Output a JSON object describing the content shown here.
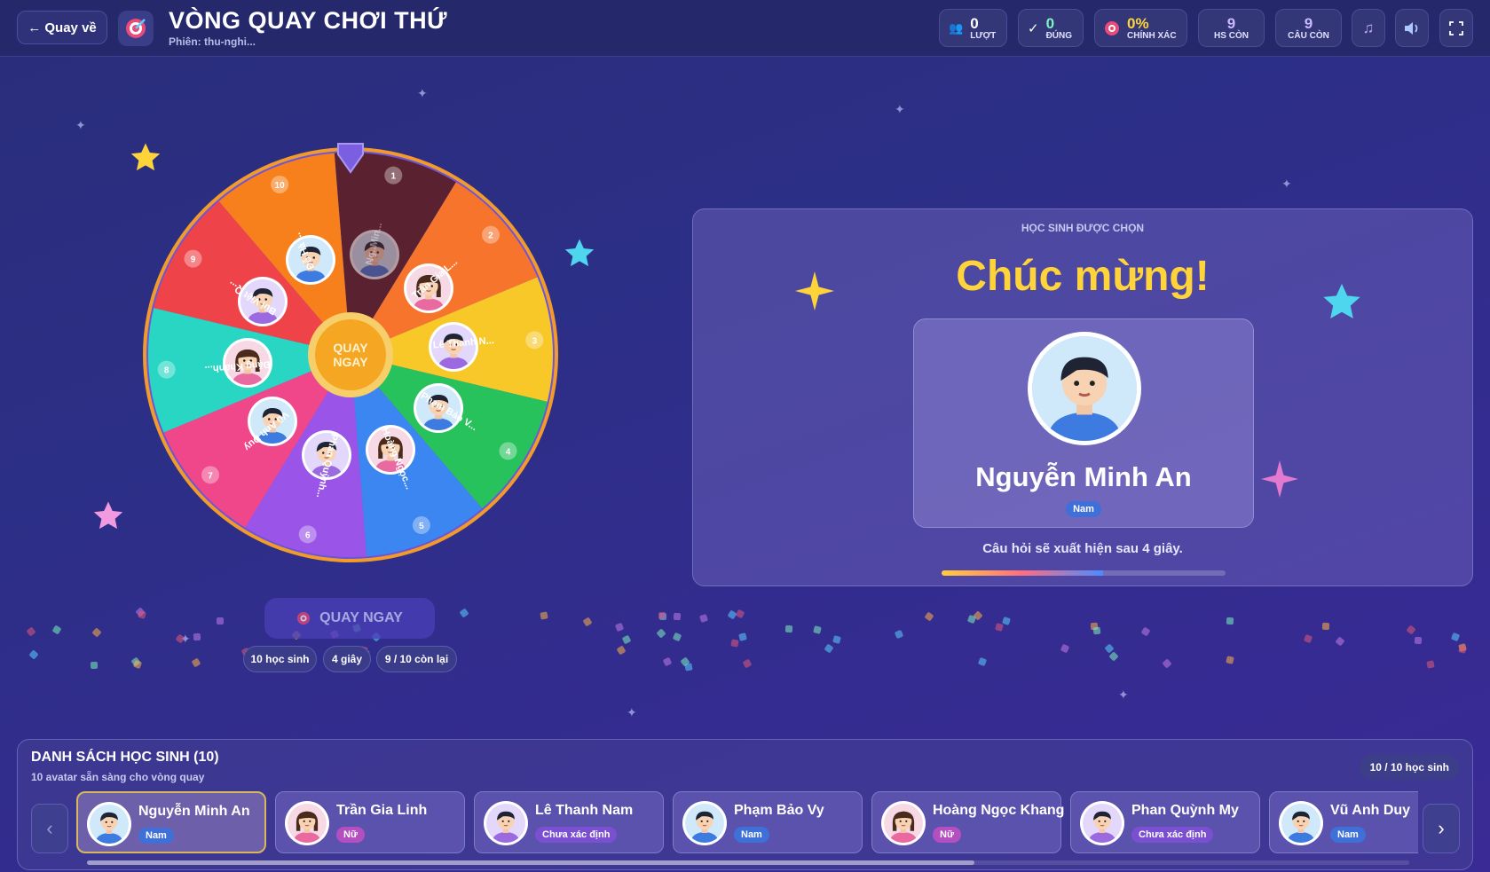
{
  "header": {
    "back_label": "← Quay về",
    "title": "VÒNG QUAY CHƠI THỨ",
    "session": "Phiên: thu-nghi...",
    "stats": [
      {
        "value": "0",
        "label": "LƯỢT",
        "icon": "users-icon",
        "color": "#ffffff"
      },
      {
        "value": "0",
        "label": "ĐÚNG",
        "icon": "check-icon",
        "color": "#7bf2c0"
      },
      {
        "value": "0%",
        "label": "CHÍNH XÁC",
        "icon": "target-icon",
        "color": "#ffd43b"
      },
      {
        "value": "9",
        "label": "HS CÒN",
        "icon": "",
        "color": "#c9b8ff"
      },
      {
        "value": "9",
        "label": "CÂU CÒN",
        "icon": "",
        "color": "#c9b8ff"
      }
    ]
  },
  "wheel": {
    "center_label": "QUAY NGAY",
    "segments": [
      {
        "num": "1",
        "label": "Ng..Min...",
        "color": "#5a2230"
      },
      {
        "num": "2",
        "label": "Trần Gia L...",
        "color": "#f7742c"
      },
      {
        "num": "3",
        "label": "Lê Thanh N...",
        "color": "#f8c829"
      },
      {
        "num": "4",
        "label": "Phạm Bảo V...",
        "color": "#28c25c"
      },
      {
        "num": "5",
        "label": "Hoàng Ngọc...",
        "color": "#3c86f2"
      },
      {
        "num": "6",
        "label": "Phan Quỳnh...",
        "color": "#9a55e8"
      },
      {
        "num": "7",
        "label": "Vũ Anh Duy",
        "color": "#f0478a"
      },
      {
        "num": "8",
        "label": "Đặng Khánh...",
        "color": "#29d6c3"
      },
      {
        "num": "9",
        "label": "Bùi Việt Q...",
        "color": "#ee4449"
      },
      {
        "num": "10",
        "label": "Đỗ Hà ...",
        "color": "#f7801c"
      }
    ]
  },
  "spin_button": "QUAY NGAY",
  "chips": [
    "10 học sinh",
    "4 giây",
    "9 / 10 còn lại"
  ],
  "result": {
    "header": "HỌC SINH ĐƯỢC CHỌN",
    "congrats": "Chúc mừng!",
    "name": "Nguyễn Minh An",
    "gender": "Nam",
    "countdown": "Câu hỏi sẽ xuất hiện sau 4 giây.",
    "progress": 0.57
  },
  "roster": {
    "title": "DANH SÁCH HỌC SINH (10)",
    "subtitle": "10 avatar sẵn sàng cho vòng quay",
    "count": "10 / 10 học sinh",
    "students": [
      {
        "name": "Nguyễn Minh An",
        "badge": "Nam",
        "type": "nam"
      },
      {
        "name": "Trần Gia Linh",
        "badge": "Nữ",
        "type": "nu"
      },
      {
        "name": "Lê Thanh Nam",
        "badge": "Chưa xác định",
        "type": "cx"
      },
      {
        "name": "Phạm Bảo Vy",
        "badge": "Nam",
        "type": "nam"
      },
      {
        "name": "Hoàng Ngọc Khang",
        "badge": "Nữ",
        "type": "nu"
      },
      {
        "name": "Phan Quỳnh My",
        "badge": "Chưa xác định",
        "type": "cx"
      },
      {
        "name": "Vũ Anh Duy",
        "badge": "Nam",
        "type": "nam"
      }
    ]
  }
}
